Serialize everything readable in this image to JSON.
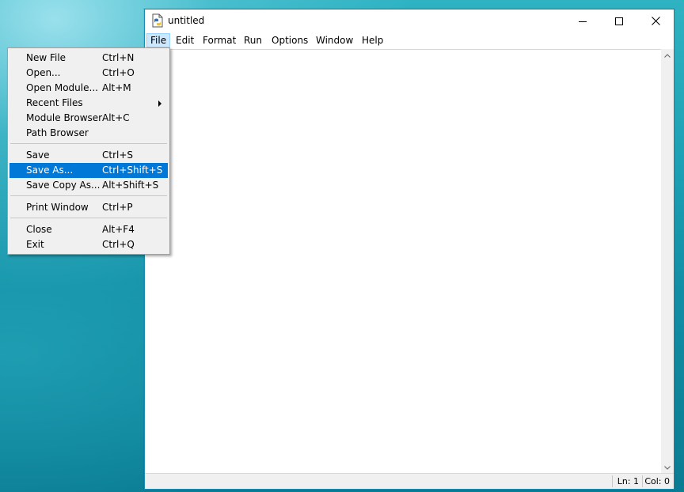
{
  "window": {
    "title": "untitled"
  },
  "menubar": {
    "items": [
      {
        "label": "File"
      },
      {
        "label": "Edit"
      },
      {
        "label": "Format"
      },
      {
        "label": "Run"
      },
      {
        "label": "Options"
      },
      {
        "label": "Window"
      },
      {
        "label": "Help"
      }
    ]
  },
  "file_menu": {
    "items": [
      {
        "label": "New File",
        "shortcut": "Ctrl+N"
      },
      {
        "label": "Open...",
        "shortcut": "Ctrl+O"
      },
      {
        "label": "Open Module...",
        "shortcut": "Alt+M"
      },
      {
        "label": "Recent Files",
        "shortcut": ""
      },
      {
        "label": "Module Browser",
        "shortcut": "Alt+C"
      },
      {
        "label": "Path Browser",
        "shortcut": ""
      },
      {
        "label": "Save",
        "shortcut": "Ctrl+S"
      },
      {
        "label": "Save As...",
        "shortcut": "Ctrl+Shift+S"
      },
      {
        "label": "Save Copy As...",
        "shortcut": "Alt+Shift+S"
      },
      {
        "label": "Print Window",
        "shortcut": "Ctrl+P"
      },
      {
        "label": "Close",
        "shortcut": "Alt+F4"
      },
      {
        "label": "Exit",
        "shortcut": "Ctrl+Q"
      }
    ],
    "highlighted": "Save As..."
  },
  "statusbar": {
    "line": "Ln: 1",
    "col": "Col: 0"
  },
  "colors": {
    "menu_highlight": "#0078d7",
    "menubar_active": "#cce8ff",
    "window_border": "#1a8ab0"
  }
}
